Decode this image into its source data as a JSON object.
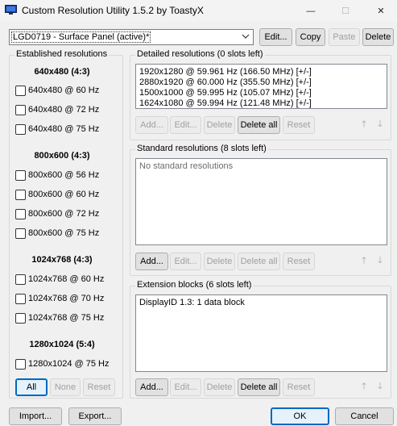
{
  "window": {
    "title": "Custom Resolution Utility 1.5.2 by ToastyX",
    "controls": {
      "minimize": "—",
      "maximize": "☐",
      "close": "✕"
    }
  },
  "top": {
    "display_select": "LGD0719 - Surface Panel (active)*",
    "edit": "Edit...",
    "copy": "Copy",
    "paste": "Paste",
    "delete": "Delete"
  },
  "established": {
    "title": "Established resolutions",
    "groups": [
      {
        "header": "640x480 (4:3)",
        "items": [
          "640x480 @ 60 Hz",
          "640x480 @ 72 Hz",
          "640x480 @ 75 Hz"
        ]
      },
      {
        "header": "800x600 (4:3)",
        "items": [
          "800x600 @ 56 Hz",
          "800x600 @ 60 Hz",
          "800x600 @ 72 Hz",
          "800x600 @ 75 Hz"
        ]
      },
      {
        "header": "1024x768 (4:3)",
        "items": [
          "1024x768 @ 60 Hz",
          "1024x768 @ 70 Hz",
          "1024x768 @ 75 Hz"
        ]
      },
      {
        "header": "1280x1024 (5:4)",
        "items": [
          "1280x1024 @ 75 Hz"
        ]
      }
    ],
    "buttons": {
      "all": "All",
      "none": "None",
      "reset": "Reset"
    }
  },
  "detailed": {
    "title": "Detailed resolutions (0 slots left)",
    "items": [
      "1920x1280 @ 59.961 Hz (166.50 MHz) [+/-]",
      "2880x1920 @ 60.000 Hz (355.50 MHz) [+/-]",
      "1500x1000 @ 59.995 Hz (105.07 MHz) [+/-]",
      "1624x1080 @ 59.994 Hz (121.48 MHz) [+/-]"
    ],
    "buttons": {
      "add": "Add...",
      "edit": "Edit...",
      "delete": "Delete",
      "delete_all": "Delete all",
      "reset": "Reset"
    }
  },
  "standard": {
    "title": "Standard resolutions (8 slots left)",
    "empty_text": "No standard resolutions",
    "buttons": {
      "add": "Add...",
      "edit": "Edit...",
      "delete": "Delete",
      "delete_all": "Delete all",
      "reset": "Reset"
    }
  },
  "extension": {
    "title": "Extension blocks (6 slots left)",
    "items": [
      "DisplayID 1.3: 1 data block"
    ],
    "buttons": {
      "add": "Add...",
      "edit": "Edit...",
      "delete": "Delete",
      "delete_all": "Delete all",
      "reset": "Reset"
    }
  },
  "bottom": {
    "import": "Import...",
    "export": "Export...",
    "ok": "OK",
    "cancel": "Cancel"
  },
  "arrows": {
    "up": "🡑",
    "down": "🡓"
  },
  "colors": {
    "accent": "#0067c0",
    "window_bg": "#f0f0f0",
    "disabled_text": "#a0a0a0"
  }
}
